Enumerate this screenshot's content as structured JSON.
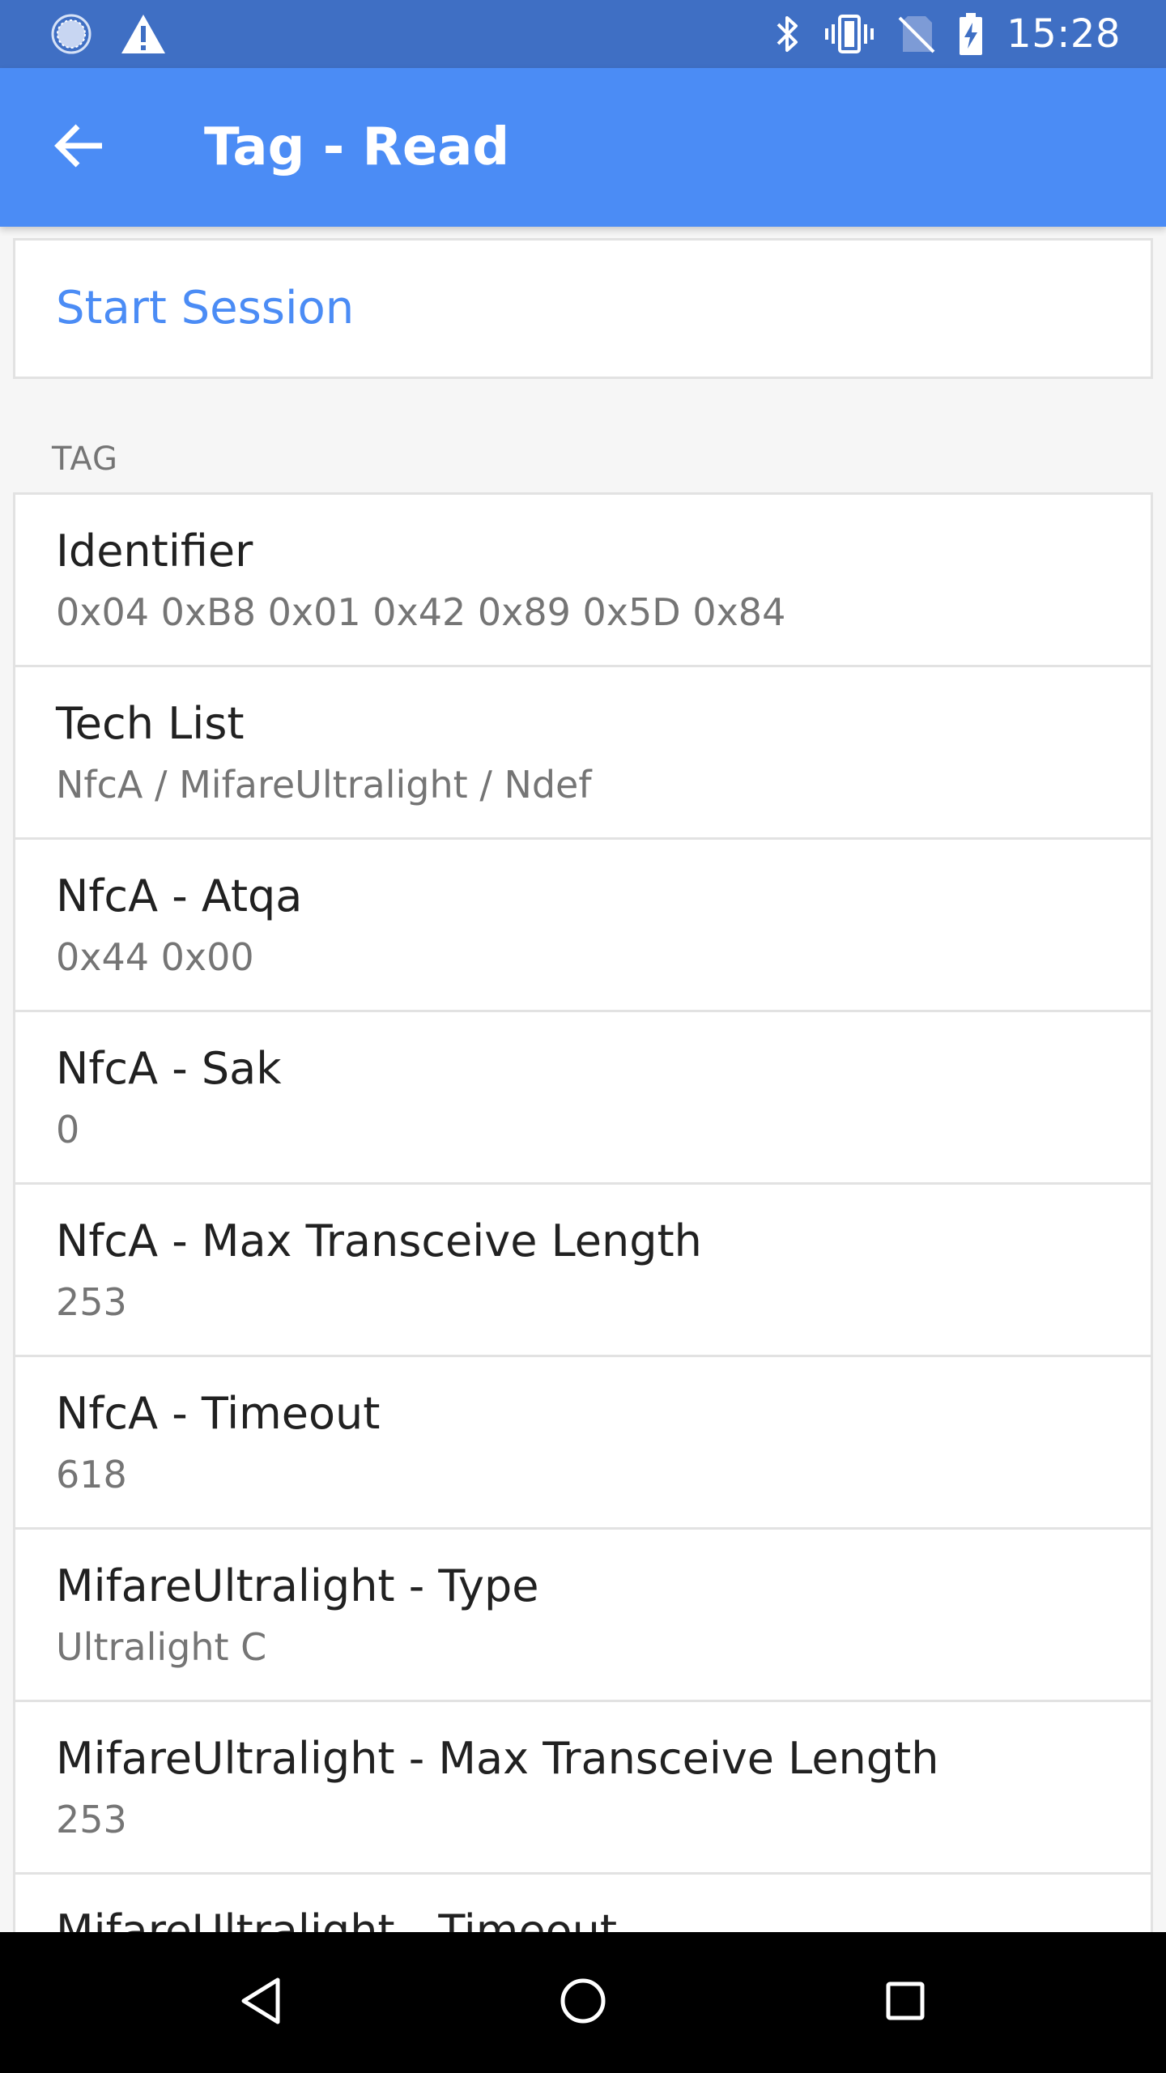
{
  "status_bar": {
    "time": "15:28",
    "icons": [
      "sync-icon",
      "warning-icon",
      "bluetooth-icon",
      "vibrate-icon",
      "no-sim-icon",
      "battery-charging-icon"
    ]
  },
  "app_bar": {
    "title": "Tag - Read",
    "back_icon": "arrow-back-icon"
  },
  "session": {
    "start_label": "Start Session"
  },
  "tag_section": {
    "header": "TAG",
    "items": [
      {
        "title": "Identifier",
        "value": "0x04 0xB8 0x01 0x42 0x89 0x5D 0x84"
      },
      {
        "title": "Tech List",
        "value": "NfcA / MifareUltralight / Ndef"
      },
      {
        "title": "NfcA - Atqa",
        "value": "0x44 0x00"
      },
      {
        "title": "NfcA - Sak",
        "value": "0"
      },
      {
        "title": "NfcA - Max Transceive Length",
        "value": "253"
      },
      {
        "title": "NfcA - Timeout",
        "value": "618"
      },
      {
        "title": "MifareUltralight - Type",
        "value": "Ultralight C"
      },
      {
        "title": "MifareUltralight - Max Transceive Length",
        "value": "253"
      },
      {
        "title": "MifareUltralight - Timeout",
        "value": ""
      }
    ]
  },
  "nav_bar": {
    "icons": [
      "nav-back-icon",
      "nav-home-icon",
      "nav-recents-icon"
    ]
  },
  "colors": {
    "status_bar": "#3f6fc4",
    "app_bar": "#4b8cf5",
    "accent": "#4b8cf5",
    "background": "#f6f6f6"
  }
}
